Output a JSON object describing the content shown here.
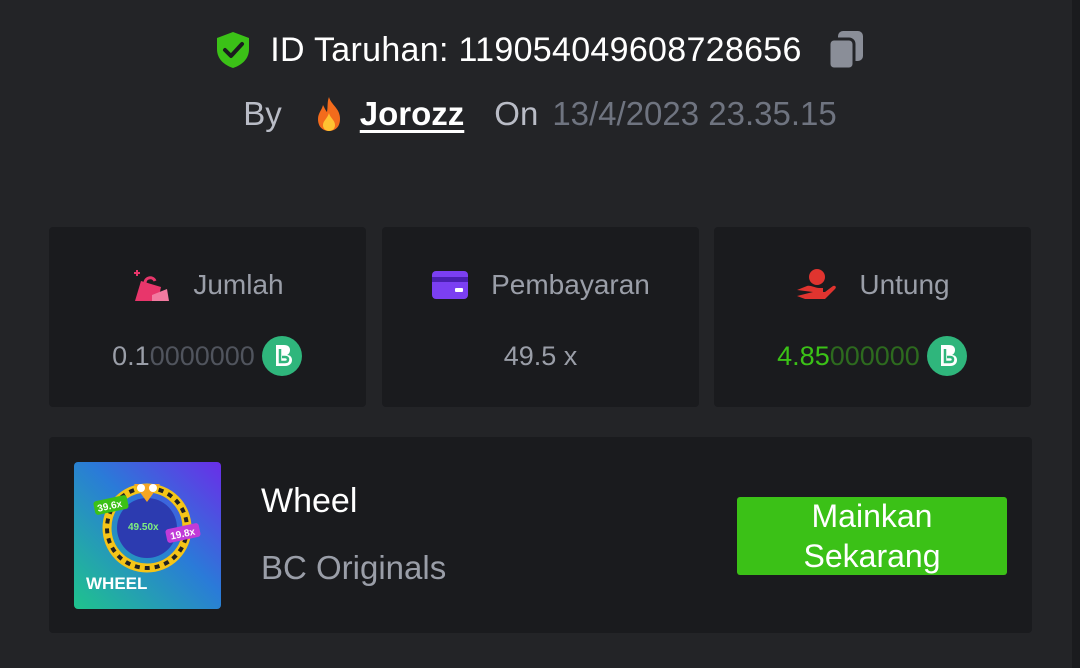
{
  "bet": {
    "id_label": "ID Taruhan:",
    "id_value": "119054049608728656"
  },
  "meta": {
    "by_label": "By",
    "username": "Jorozz",
    "on_label": "On",
    "datetime": "13/4/2023 23.35.15"
  },
  "stats": {
    "amount": {
      "label": "Jumlah",
      "value_main": "0.1",
      "value_faded": "0000000",
      "icon": "money-bag-icon"
    },
    "payout": {
      "label": "Pembayaran",
      "value": "49.5 x",
      "icon": "card-icon"
    },
    "profit": {
      "label": "Untung",
      "value_main": "4.85",
      "value_faded": "000000",
      "icon": "hand-coin-icon"
    }
  },
  "game": {
    "title": "Wheel",
    "provider": "BC Originals",
    "thumb_text": "WHEEL",
    "thumb_mult_1": "39.6x",
    "thumb_mult_2": "49.50x",
    "thumb_mult_3": "19.8x",
    "play_label": "Mainkan\nSekarang"
  },
  "colors": {
    "background": "#232427",
    "card": "#1a1b1e",
    "profit_green": "#3bc117",
    "shield_green": "#3bc117",
    "coin_teal": "#2fb67c",
    "amount_pink": "#e8366b",
    "payout_purple": "#7b3ff2",
    "profit_red": "#e0342f"
  }
}
